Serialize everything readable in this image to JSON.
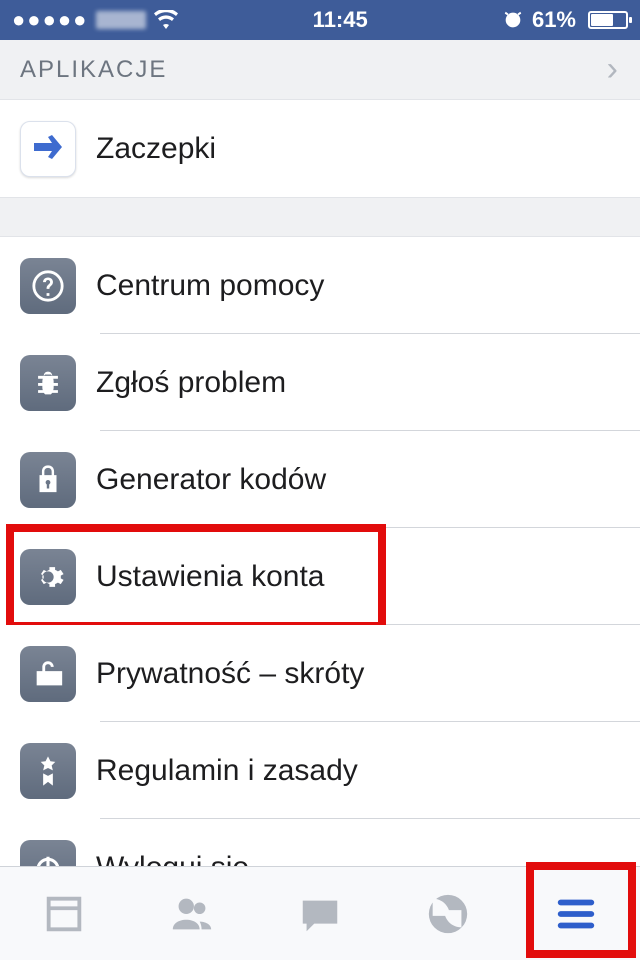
{
  "status": {
    "time": "11:45",
    "battery_pct": "61%"
  },
  "section": {
    "header": "APLIKACJE"
  },
  "apps": {
    "poke": "Zaczepki"
  },
  "settings": {
    "help": "Centrum pomocy",
    "report": "Zgłoś problem",
    "codegen": "Generator kodów",
    "account": "Ustawienia konta",
    "privacy": "Prywatność – skróty",
    "terms": "Regulamin i zasady",
    "logout": "Wyloguj się"
  }
}
